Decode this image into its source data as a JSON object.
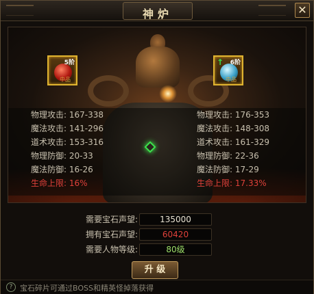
{
  "window": {
    "title": "神炉",
    "close_label": "✕"
  },
  "left_gem": {
    "level": "5阶",
    "bottom_label": "中品"
  },
  "right_gem": {
    "level": "6阶",
    "bottom_label": "中品",
    "upgrade_arrow": "↑"
  },
  "stats_left": [
    {
      "label": "物理攻击:",
      "value": "167-338"
    },
    {
      "label": "魔法攻击:",
      "value": "141-296"
    },
    {
      "label": "道术攻击:",
      "value": "153-316"
    },
    {
      "label": "物理防御:",
      "value": "20-33"
    },
    {
      "label": "魔法防御:",
      "value": "16-26"
    },
    {
      "label": "生命上限:",
      "value": "16%"
    }
  ],
  "stats_right": [
    {
      "label": "物理攻击:",
      "value": "176-353"
    },
    {
      "label": "魔法攻击:",
      "value": "148-308"
    },
    {
      "label": "道术攻击:",
      "value": "161-329"
    },
    {
      "label": "物理防御:",
      "value": "22-36"
    },
    {
      "label": "魔法防御:",
      "value": "17-29"
    },
    {
      "label": "生命上限:",
      "value": "17.33%"
    }
  ],
  "requirements": [
    {
      "label": "需要宝石声望:",
      "value": "135000",
      "color": "#e8e2d2"
    },
    {
      "label": "拥有宝石声望:",
      "value": "60420",
      "color": "#e0413a"
    },
    {
      "label": "需要人物等级:",
      "value": "80级",
      "color": "#9ee06a"
    }
  ],
  "upgrade_label": "升 级",
  "hint": "宝石碎片可通过BOSS和精英怪掉落获得",
  "colors": {
    "gold": "#e0b430",
    "red": "#e0413a",
    "green": "#3ce04c"
  }
}
